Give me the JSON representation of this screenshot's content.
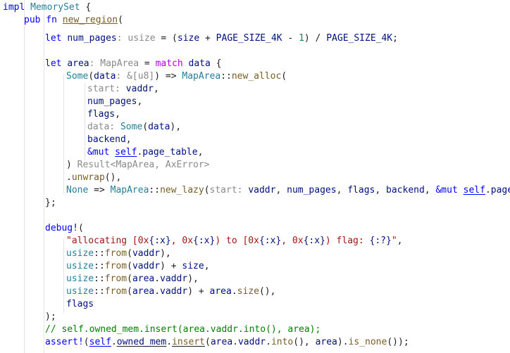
{
  "editor": {
    "lines": [
      "impl MemorySet {",
      "    pub fn new_region(",
      "        let num_pages: usize = (size + PAGE_SIZE_4K - 1) / PAGE_SIZE_4K;",
      "",
      "        let area: MapArea = match data {",
      "            Some(data: &[u8]) => MapArea::new_alloc(",
      "                start: vaddr,",
      "                num_pages,",
      "                flags,",
      "                data: Some(data),",
      "                backend,",
      "                &mut self.page_table,",
      "            ) Result<MapArea, AxError>",
      "            .unwrap(),",
      "            None => MapArea::new_lazy(start: vaddr, num_pages, flags, backend, &mut self.page_tab",
      "        };",
      "",
      "        debug!(",
      "            \"allocating [0x{:x}, 0x{:x}) to [0x{:x}, 0x{:x}) flag: {:?}\",",
      "            usize::from(vaddr),",
      "            usize::from(vaddr) + size,",
      "            usize::from(area.vaddr),",
      "            usize::from(area.vaddr) + area.size(),",
      "            flags",
      "        );",
      "        // self.owned_mem.insert(area.vaddr.into(), area);",
      "        assert!(self.owned_mem.insert(area.vaddr.into(), area).is_none());"
    ]
  }
}
